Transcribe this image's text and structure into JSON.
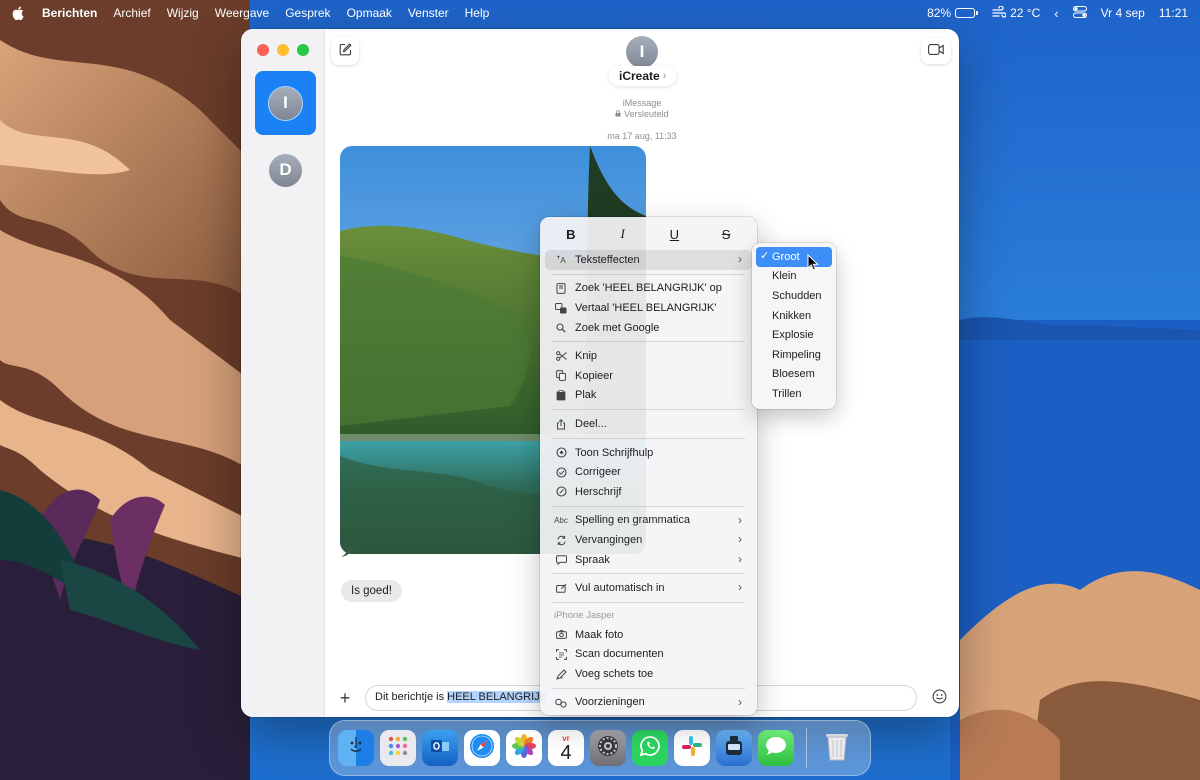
{
  "menubar": {
    "app_name": "Berichten",
    "menus": [
      "Archief",
      "Wijzig",
      "Weergave",
      "Gesprek",
      "Opmaak",
      "Venster",
      "Help"
    ],
    "battery_percent": "82%",
    "battery_level": 0.82,
    "weather": "22 °C",
    "date": "Vr 4 sep",
    "time": "11:21",
    "icons": [
      "apple-icon",
      "battery-icon",
      "weather-icon",
      "chevron-left-icon",
      "control-center-icon"
    ]
  },
  "sidebar": {
    "conversations": [
      {
        "initial": "I",
        "selected": true
      },
      {
        "initial": "D",
        "selected": false
      }
    ]
  },
  "header": {
    "avatar_initial": "I",
    "contact_name": "iCreate",
    "contact_chevron": "›",
    "service": "iMessage",
    "encryption": "Versleuteld",
    "timestamp": "ma 17 aug, 11:33"
  },
  "messages": {
    "reply_text": "Is goed!"
  },
  "composer": {
    "plus": "+",
    "text_before": "Dit berichtje is ",
    "text_selected": "HEEL BELANGRIJK"
  },
  "context_menu": {
    "format_buttons": [
      "B",
      "I",
      "U",
      "S"
    ],
    "items": {
      "teksteffecten": "Teksteffecten",
      "zoek_op": "Zoek 'HEEL BELANGRIJK' op",
      "vertaal": "Vertaal 'HEEL BELANGRIJK'",
      "zoek_google": "Zoek met Google",
      "knip": "Knip",
      "kopieer": "Kopieer",
      "plak": "Plak",
      "deel": "Deel...",
      "schrijfhulp": "Toon Schrijfhulp",
      "corrigeer": "Corrigeer",
      "herschrijf": "Herschrijf",
      "spelling": "Spelling en grammatica",
      "vervangingen": "Vervangingen",
      "spraak": "Spraak",
      "vul_in": "Vul automatisch in",
      "device_header": "iPhone Jasper",
      "maak_foto": "Maak foto",
      "scan": "Scan documenten",
      "schets": "Voeg schets toe",
      "voorzieningen": "Voorzieningen"
    },
    "spelling_icon_text": "Abc",
    "teksteffecten_icon_text": "ꜛA"
  },
  "submenu": {
    "items": [
      "Groot",
      "Klein",
      "Schudden",
      "Knikken",
      "Explosie",
      "Rimpeling",
      "Bloesem",
      "Trillen"
    ],
    "checked": "Groot",
    "checkmark": "✓"
  },
  "dock": {
    "calendar_month": "vr",
    "calendar_day": "4",
    "apps": [
      "finder",
      "launchpad",
      "outlook",
      "safari",
      "photos",
      "calendar",
      "system-settings",
      "whatsapp",
      "slack",
      "ink",
      "messages",
      "trash"
    ]
  },
  "colors": {
    "accent": "#1a82f5",
    "highlight": "#3d8ef7",
    "selection": "#b3d4fc"
  }
}
